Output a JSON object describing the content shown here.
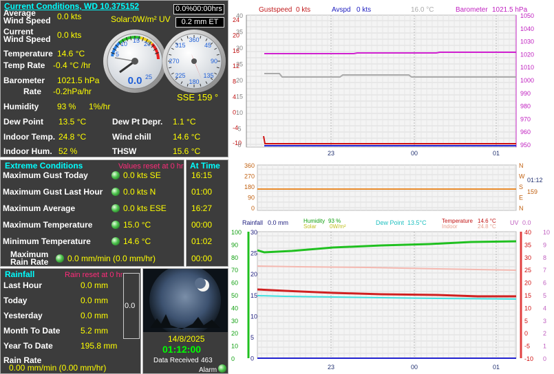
{
  "current": {
    "title": "Current Conditions, WD 10.375152",
    "avg_label": "Average\nWind Speed",
    "avg_value": "0.0 kts",
    "cur_label": "Current\nWind Speed",
    "cur_value": "0.0 kts",
    "solar": "Solar:0W/m² UV",
    "rain_rate_box": "0.0%00:00hrs",
    "et_box": "0.2 mm ET",
    "temp_label": "Temperature",
    "temp_value": "14.6 °C",
    "temprate_label": "Temp Rate",
    "temprate_value": "-0.4 °C /hr",
    "baro_label": "Barometer",
    "baro_value": "1021.5 hPa",
    "rate_label": "Rate",
    "rate_value": "-0.2hPa/hr",
    "hum_label": "Humidity",
    "hum_value": "93 %",
    "hum_rate": "1%/hr",
    "gauge_speed": "0.0",
    "direction": "SSE  159 °",
    "dew_label": "Dew Point",
    "dew_value": "13.5 °C",
    "dewdepr_label": "Dew Pt Depr.",
    "dewdepr_value": "1.1 °C",
    "indoor_label": "Indoor Temp.",
    "indoor_value": "24.8 °C",
    "chill_label": "Wind chill",
    "chill_value": "14.6 °C",
    "inhum_label": "Indoor Hum.",
    "inhum_value": "52 %",
    "thsw_label": "THSW",
    "thsw_value": "15.6 °C"
  },
  "gauge": {
    "speed_ticks": [
      "5",
      "10",
      "15",
      "20",
      "25"
    ],
    "compass_ticks": [
      "360",
      "45",
      "90",
      "135",
      "180",
      "225",
      "270",
      "315"
    ]
  },
  "extreme": {
    "title": "Extreme Conditions",
    "reset": "Values reset at 0 hr",
    "rows": [
      {
        "label": "Maximum Gust Today",
        "value": "0.0 kts SE",
        "time": "16:15"
      },
      {
        "label": "Maximum Gust Last Hour",
        "value": "0.0 kts  N",
        "time": "01:00"
      },
      {
        "label": "Maximum Average",
        "value": "0.0 kts ESE",
        "time": "16:27"
      },
      {
        "label": "Maximum Temperature",
        "value": "15.0 °C",
        "time": "00:00"
      },
      {
        "label": "Minimum Temperature",
        "value": "14.6 °C",
        "time": "01:02"
      }
    ],
    "maxrain_label": "Maximum\nRain Rate",
    "maxrain_value": "0.0 mm/min (0.0 mm/hr)",
    "maxrain_time": "00:00",
    "at_time": "At Time"
  },
  "rainfall": {
    "title": "Rainfall",
    "reset": "Rain reset at 0 hr",
    "rows": [
      {
        "label": "Last Hour",
        "value": "0.0 mm"
      },
      {
        "label": "Today",
        "value": "0.0 mm"
      },
      {
        "label": "Yesterday",
        "value": "0.0 mm"
      },
      {
        "label": "Month To Date",
        "value": "5.2 mm"
      },
      {
        "label": "Year To Date",
        "value": "195.8 mm"
      }
    ],
    "rate_label": "Rain Rate",
    "rate_value": "0.00 mm/min (0.00 mm/hr)",
    "gauge_value": "0.0"
  },
  "status": {
    "date": "14/8/2025",
    "time": "01:12:00",
    "received_label": "Data Received",
    "received_value": "463",
    "alarm": "Alarm"
  },
  "charts": {
    "wind": {
      "gust_label": "Gustspeed",
      "gust_value": "0 kts",
      "avg_label": "Avspd",
      "avg_value": "0 kts",
      "temp_value": "16.0 °C",
      "baro_label": "Barometer",
      "baro_value": "1021.5 hPa",
      "left_ticks": [
        "24",
        "20",
        "16",
        "12",
        "8",
        "4",
        "0",
        "-4",
        "-10"
      ],
      "right_ticks": [
        "1050",
        "1040",
        "1030",
        "1020",
        "1010",
        "1000",
        "990",
        "980",
        "970",
        "960",
        "950"
      ],
      "x_ticks": [
        "23",
        "00",
        "01"
      ],
      "left_top": "40",
      "left_mid": [
        "35",
        "30",
        "25",
        "20",
        "15",
        "10",
        "5",
        "0"
      ]
    },
    "dir": {
      "left_ticks": [
        "360",
        "270",
        "180",
        "90",
        "0"
      ],
      "right_letters": [
        "N",
        "W",
        "S",
        "E",
        "N"
      ],
      "time": "01:12",
      "dir_value": "159"
    },
    "rain": {
      "rain_label": "Rainfall",
      "rain_value": "0.0 mm",
      "hum_label": "Humidity",
      "hum_value": "93 %",
      "solar_label": "Solar",
      "solar_value": "0W/m²",
      "dew_label": "Dew Point",
      "dew_value": "13.5°C",
      "temp_label": "Temperature",
      "temp_value": "14.6 °C",
      "indoor_label": "Indoor",
      "indoor_value": "24.8 °C",
      "uv_label": "UV",
      "uv_value": "0.0",
      "left1_ticks": [
        "100",
        "90",
        "80",
        "70",
        "60",
        "50",
        "40",
        "30",
        "20",
        "10",
        "0"
      ],
      "left2_ticks": [
        "30",
        "25",
        "20",
        "15",
        "10",
        "5",
        "0"
      ],
      "right1_ticks": [
        "40",
        "35",
        "30",
        "25",
        "20",
        "15",
        "10",
        "5",
        "0",
        "-5",
        "-10"
      ],
      "right2_ticks": [
        "10",
        "9",
        "8",
        "7",
        "6",
        "5",
        "4",
        "3",
        "2",
        "1",
        "0"
      ],
      "x_ticks": [
        "23",
        "00",
        "01"
      ]
    }
  },
  "colors": {
    "panel": "#3c3c3c",
    "label": "#ffffff",
    "value": "#ffff00",
    "header": "#00ffff",
    "reset": "#ff2b7a",
    "time": "#00ff00"
  }
}
